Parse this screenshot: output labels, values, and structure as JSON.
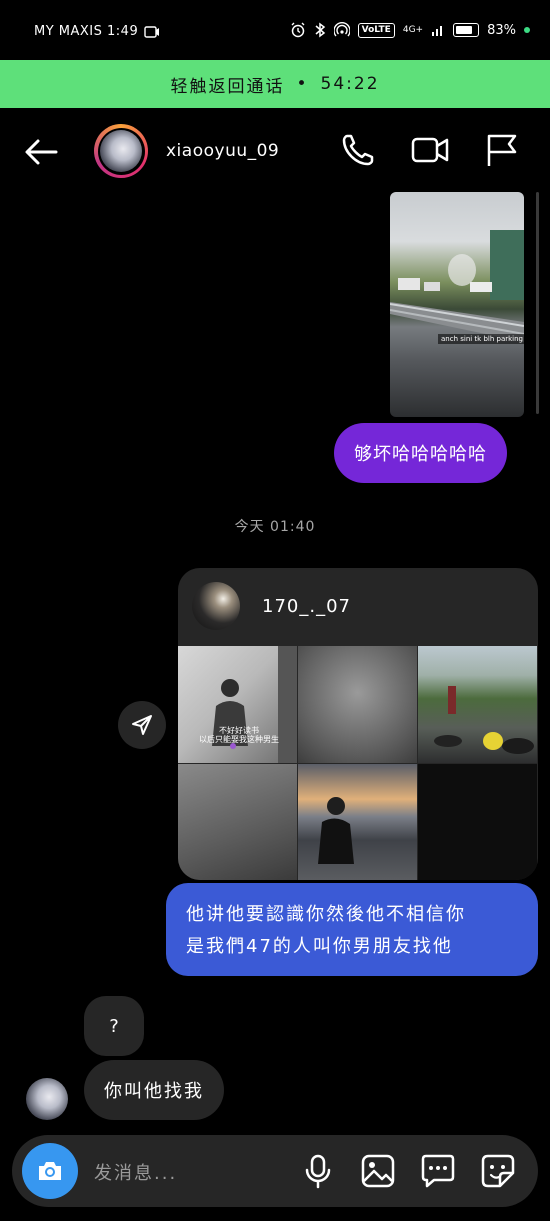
{
  "status_bar": {
    "carrier_time": "MY MAXIS 1:49",
    "battery": "83%",
    "volte": "VoLTE",
    "network": "4G+"
  },
  "call_banner": {
    "label": "轻触返回通话",
    "separator": "•",
    "duration": "54:22"
  },
  "header": {
    "username": "xiaooyuu_09",
    "icons": [
      "back-arrow-icon",
      "phone-icon",
      "video-camera-icon",
      "flag-icon"
    ]
  },
  "messages": {
    "media_caption": "anch sini tk blh parking leh sii",
    "outgoing_1": "够坏哈哈哈哈哈",
    "timestamp": "今天 01:40",
    "shared_profile": {
      "username": "170_._07",
      "thumb_caption_line1": "不好好读书",
      "thumb_caption_line2": "以后只能娶我这种男生"
    },
    "outgoing_2_line1": "他讲他要認識你然後他不相信你",
    "outgoing_2_line2": "是我們47的人叫你男朋友找他",
    "incoming_1": "?",
    "incoming_2": "你叫他找我"
  },
  "composer": {
    "placeholder": "发消息...",
    "icons": [
      "camera-icon",
      "microphone-icon",
      "gallery-icon",
      "chat-bubble-icon",
      "sticker-icon"
    ]
  },
  "colors": {
    "call_banner": "#5ee07a",
    "outgoing_purple": "#7527d8",
    "outgoing_blue": "#3b5ad6",
    "incoming_gray": "#262626",
    "camera_blue": "#3797f0"
  }
}
